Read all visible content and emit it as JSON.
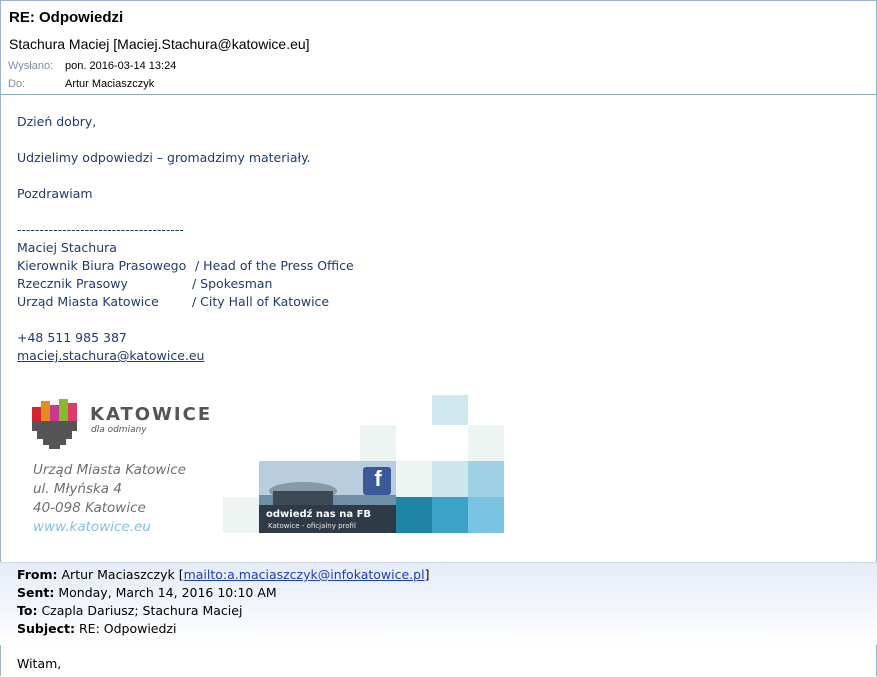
{
  "header": {
    "subject": "RE: Odpowiedzi",
    "sender": "Stachura Maciej [Maciej.Stachura@katowice.eu]",
    "sent_label": "Wysłano:",
    "sent_value": "pon. 2016-03-14 13:24",
    "to_label": "Do:",
    "to_value": "Artur Maciaszczyk"
  },
  "body": {
    "greeting": "Dzień dobry,",
    "message": "Udzielimy odpowiedzi – gromadzimy materiały.",
    "closing": "Pozdrawiam",
    "divider": "-------------------------------------",
    "sig_name": "Maciej Stachura",
    "sig_rows": [
      {
        "pl": "Kierownik Biura Prasowego",
        "en": "/ Head of the Press Office"
      },
      {
        "pl": "Rzecznik Prasowy",
        "en": "/ Spokesman"
      },
      {
        "pl": "Urząd Miasta Katowice",
        "en": "/ City Hall of Katowice"
      }
    ],
    "phone": "+48 511 985 387",
    "email": "maciej.stachura@katowice.eu"
  },
  "logo": {
    "name": "KATOWICE",
    "tagline": "dla odmiany",
    "addr1": "Urząd Miasta Katowice",
    "addr2": "ul. Młyńska 4",
    "addr3": "40-098 Katowice",
    "addr4": "www.katowice.eu",
    "fb_line1": "odwiedź nas na FB",
    "fb_line2": "Katowice - oficjalny profil",
    "fb_icon": "f",
    "colors": {
      "red": "#d3232f",
      "orange": "#e98a1e",
      "pink": "#c63b8f",
      "green": "#8bb92e",
      "gray": "#555555",
      "teal": "#2a8fb7"
    }
  },
  "quoted": {
    "from_label": "From:",
    "from_name": "Artur Maciaszczyk",
    "from_link": "mailto:a.maciaszczyk@infokatowice.pl",
    "sent_label": "Sent:",
    "sent_value": "Monday, March 14, 2016 10:10 AM",
    "to_label": "To:",
    "to_value": "Czapla Dariusz; Stachura Maciej",
    "subject_label": "Subject:",
    "subject_value": "RE: Odpowiedzi",
    "greeting": "Witam,"
  }
}
